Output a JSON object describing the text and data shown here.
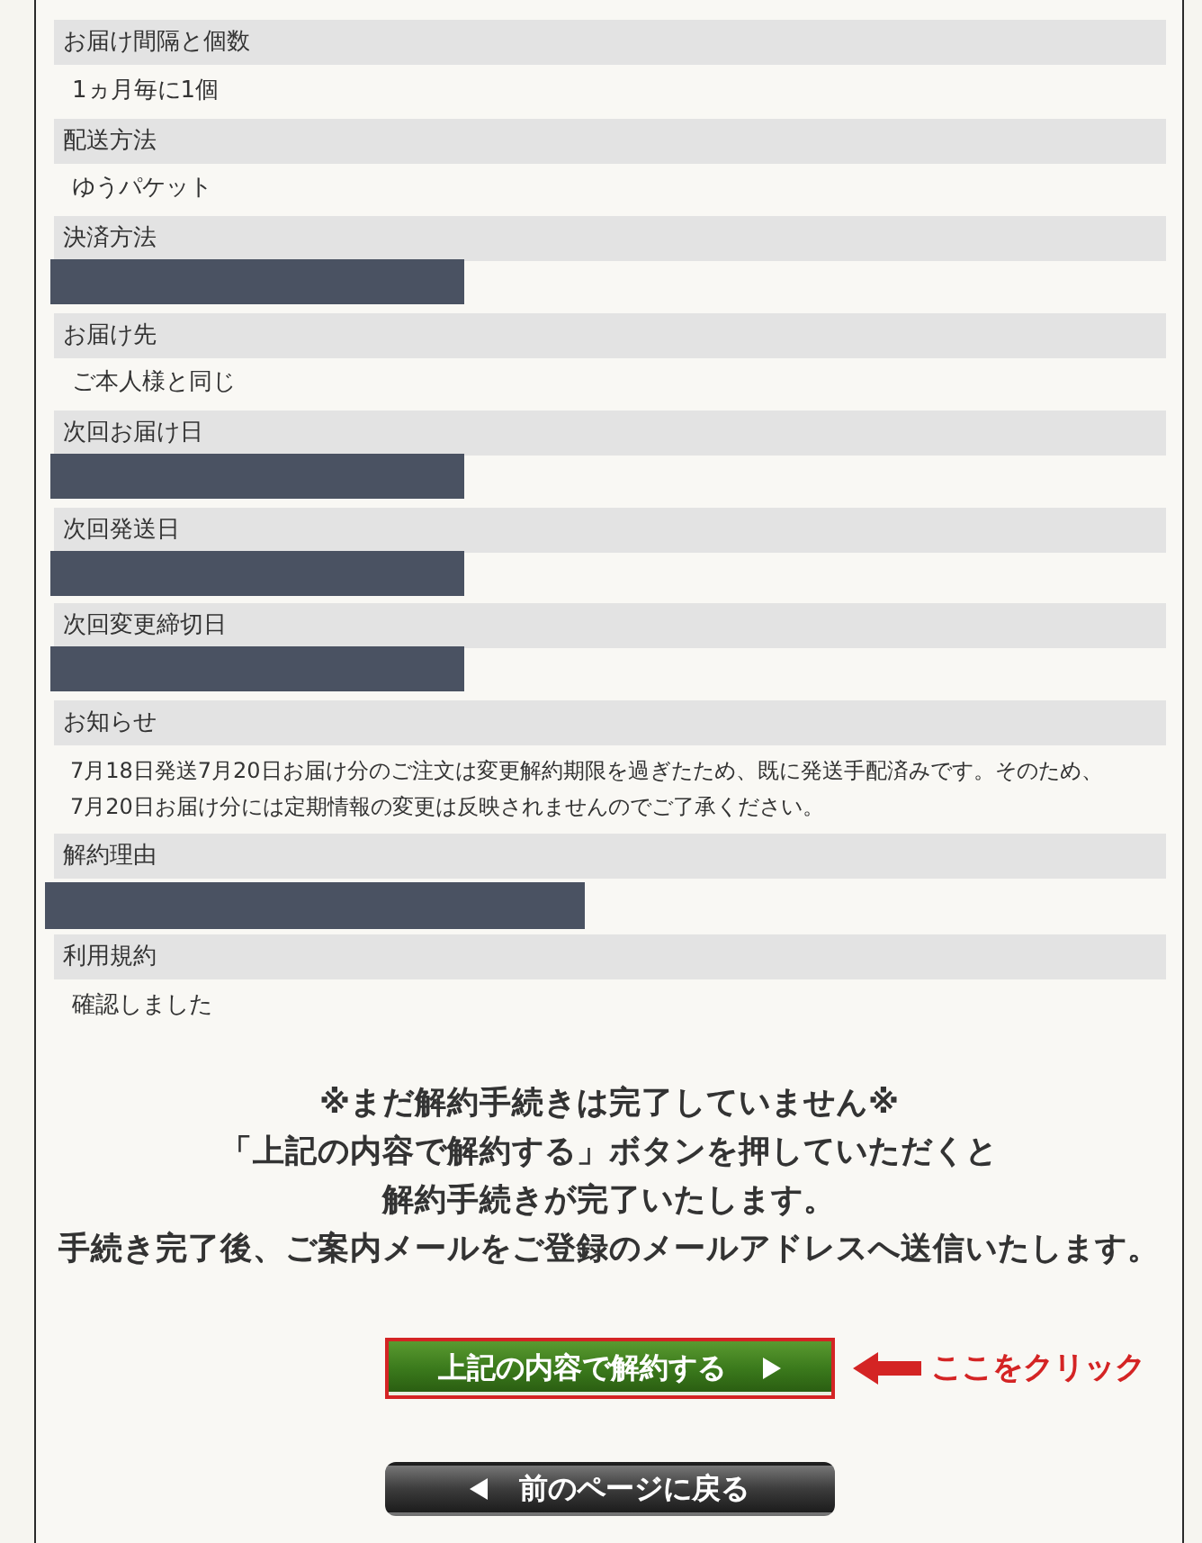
{
  "fields": [
    {
      "label": "お届け間隔と個数",
      "kind": "text",
      "value": "1ヵ月毎に1個"
    },
    {
      "label": "配送方法",
      "kind": "text",
      "value": "ゆうパケット"
    },
    {
      "label": "決済方法",
      "kind": "redacted"
    },
    {
      "label": "お届け先",
      "kind": "text",
      "value": "ご本人様と同じ"
    },
    {
      "label": "次回お届け日",
      "kind": "redacted"
    },
    {
      "label": "次回発送日",
      "kind": "redacted"
    },
    {
      "label": "次回変更締切日",
      "kind": "redacted"
    },
    {
      "label": "お知らせ",
      "kind": "note",
      "value": "7月18日発送7月20日お届け分のご注文は変更解約期限を過ぎたため、既に発送手配済みです。そのため、7月20日お届け分には定期情報の変更は反映されませんのでご了承ください。"
    },
    {
      "label": "解約理由",
      "kind": "redacted_wide"
    },
    {
      "label": "利用規約",
      "kind": "text",
      "value": "確認しました"
    }
  ],
  "message": {
    "lines": [
      "※まだ解約手続きは完了していません※",
      "「上記の内容で解約する」ボタンを押していただくと",
      "解約手続きが完了いたします。",
      "手続き完了後、ご案内メールをご登録のメールアドレスへ送信いたします。"
    ]
  },
  "buttons": [
    {
      "label": "上記の内容で解約する",
      "kind": "submit",
      "highlighted": true
    },
    {
      "label": "前のページに戻る",
      "kind": "back",
      "highlighted": false
    }
  ],
  "annotation": {
    "text": "ここをクリック"
  }
}
